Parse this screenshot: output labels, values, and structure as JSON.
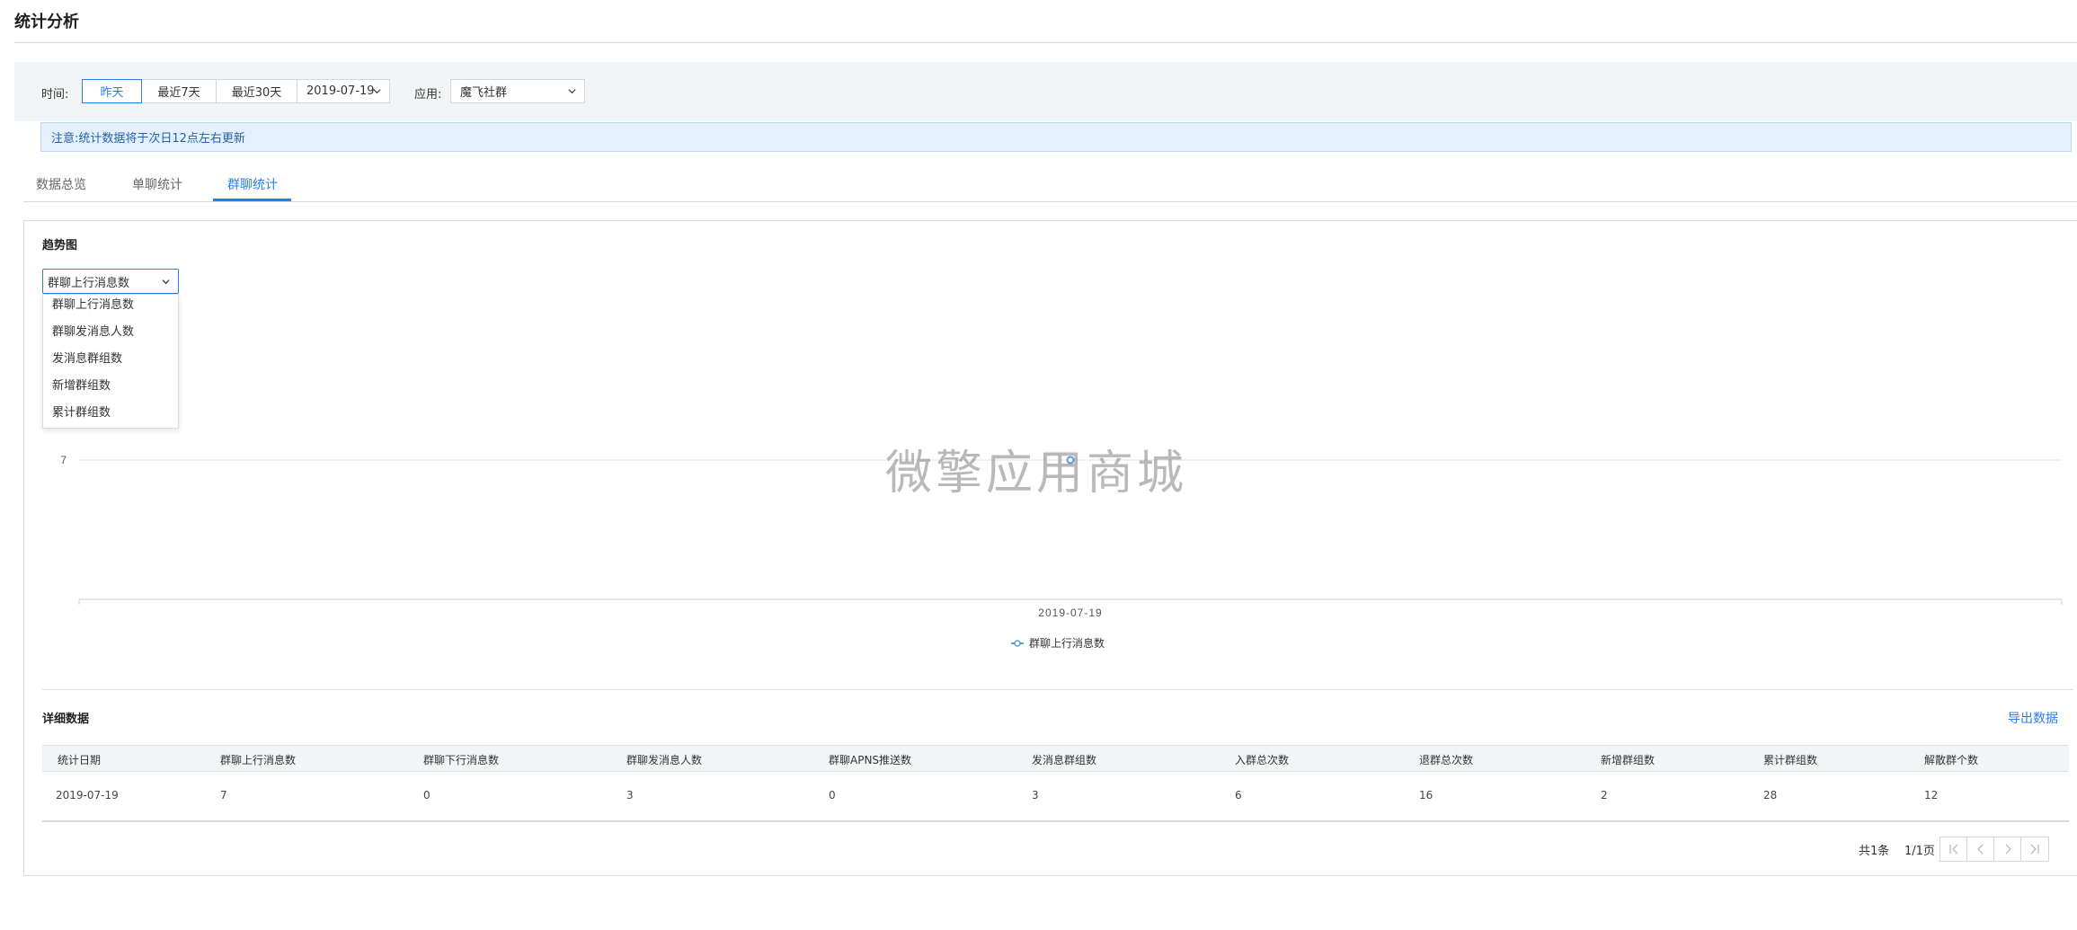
{
  "page": {
    "title": "统计分析"
  },
  "filters": {
    "time_label": "时间:",
    "time_options": [
      "昨天",
      "最近7天",
      "最近30天"
    ],
    "active_time": "昨天",
    "date_value": "2019-07-19",
    "app_label": "应用:",
    "app_value": "魔飞社群"
  },
  "notice": "注意:统计数据将于次日12点左右更新",
  "tabs": [
    {
      "label": "数据总览",
      "active": false
    },
    {
      "label": "单聊统计",
      "active": false
    },
    {
      "label": "群聊统计",
      "active": true
    }
  ],
  "trend": {
    "title": "趋势图",
    "selected_metric": "群聊上行消息数",
    "options": [
      "群聊上行消息数",
      "群聊发消息人数",
      "发消息群组数",
      "新增群组数",
      "累计群组数"
    ]
  },
  "chart_data": {
    "type": "line",
    "x": [
      "2019-07-19"
    ],
    "series": [
      {
        "name": "群聊上行消息数",
        "values": [
          7
        ]
      }
    ],
    "y_ticks": [
      7
    ],
    "x_tick_labels": [
      "2019-07-19"
    ],
    "legend_position": "bottom-center",
    "grid": true,
    "color": "#5b9bd5"
  },
  "watermark": "微擎应用商城",
  "detail": {
    "title": "详细数据",
    "export_label": "导出数据",
    "columns": [
      "统计日期",
      "群聊上行消息数",
      "群聊下行消息数",
      "群聊发消息人数",
      "群聊APNS推送数",
      "发消息群组数",
      "入群总次数",
      "退群总次数",
      "新增群组数",
      "累计群组数",
      "解散群个数"
    ],
    "rows": [
      [
        "2019-07-19",
        "7",
        "0",
        "3",
        "0",
        "3",
        "6",
        "16",
        "2",
        "28",
        "12"
      ]
    ]
  },
  "pagination": {
    "total": "共1条",
    "page": "1/1页"
  },
  "colors": {
    "accent": "#2a7cf0",
    "line": "#5b9bd5",
    "notice_bg": "#e4f0fc",
    "filter_bg": "#f2f4f5"
  }
}
